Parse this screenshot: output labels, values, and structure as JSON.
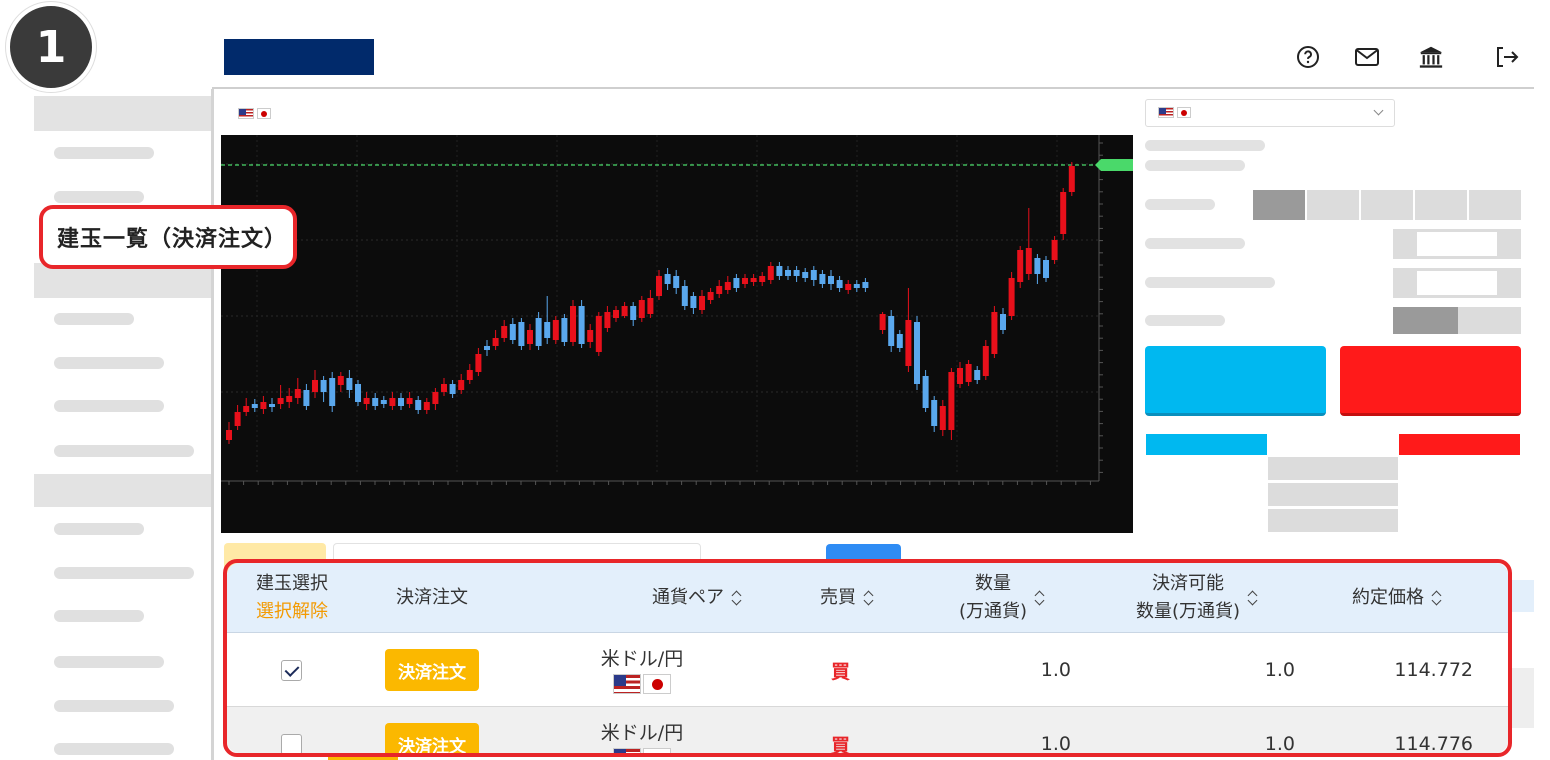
{
  "step": {
    "number": "1"
  },
  "callout": {
    "label": "建玉一覧（決済注文）"
  },
  "header": {
    "icons": [
      "help-icon",
      "mail-icon",
      "bank-icon",
      "logout-icon"
    ],
    "brand_color": "#012a6b"
  },
  "colors": {
    "candle_up": "#e8101b",
    "candle_down": "#5aa8ee",
    "price_line": "#4ad96a",
    "buy_button": "#00b8f0",
    "sell_button": "#ff1a1a",
    "order_button": "#fbb800",
    "highlight": "#e8262a"
  },
  "chart_data": {
    "type": "candlestick",
    "candles": [
      [
        0,
        430,
        440,
        422,
        444
      ],
      [
        0,
        412,
        426,
        405,
        430
      ],
      [
        0,
        406,
        412,
        398,
        416
      ],
      [
        1,
        404,
        408,
        399,
        412
      ],
      [
        0,
        402,
        409,
        396,
        414
      ],
      [
        1,
        404,
        407,
        398,
        412
      ],
      [
        0,
        398,
        404,
        385,
        409
      ],
      [
        0,
        396,
        402,
        388,
        408
      ],
      [
        0,
        389,
        398,
        378,
        404
      ],
      [
        1,
        390,
        406,
        384,
        410
      ],
      [
        0,
        380,
        392,
        370,
        398
      ],
      [
        1,
        380,
        392,
        376,
        402
      ],
      [
        1,
        378,
        406,
        372,
        412
      ],
      [
        0,
        376,
        385,
        372,
        392
      ],
      [
        1,
        378,
        390,
        370,
        398
      ],
      [
        1,
        384,
        402,
        380,
        406
      ],
      [
        0,
        398,
        404,
        392,
        410
      ],
      [
        1,
        398,
        406,
        393,
        410
      ],
      [
        1,
        400,
        404,
        396,
        408
      ],
      [
        0,
        398,
        406,
        392,
        410
      ],
      [
        1,
        398,
        406,
        393,
        410
      ],
      [
        0,
        398,
        404,
        392,
        408
      ],
      [
        1,
        400,
        410,
        396,
        414
      ],
      [
        0,
        402,
        410,
        398,
        414
      ],
      [
        0,
        392,
        404,
        388,
        410
      ],
      [
        0,
        384,
        392,
        378,
        396
      ],
      [
        1,
        384,
        394,
        380,
        398
      ],
      [
        0,
        380,
        390,
        374,
        394
      ],
      [
        0,
        370,
        380,
        364,
        384
      ],
      [
        0,
        354,
        372,
        348,
        376
      ],
      [
        1,
        346,
        350,
        340,
        356
      ],
      [
        0,
        338,
        346,
        330,
        350
      ],
      [
        0,
        326,
        338,
        320,
        342
      ],
      [
        1,
        324,
        340,
        318,
        344
      ],
      [
        1,
        322,
        346,
        318,
        350
      ],
      [
        0,
        330,
        344,
        324,
        350
      ],
      [
        1,
        318,
        346,
        312,
        350
      ],
      [
        1,
        322,
        338,
        296,
        344
      ],
      [
        0,
        320,
        340,
        316,
        344
      ],
      [
        1,
        318,
        342,
        314,
        346
      ],
      [
        0,
        306,
        342,
        300,
        346
      ],
      [
        1,
        306,
        344,
        300,
        348
      ],
      [
        0,
        330,
        342,
        324,
        348
      ],
      [
        0,
        316,
        352,
        312,
        356
      ],
      [
        0,
        312,
        328,
        306,
        332
      ],
      [
        0,
        310,
        318,
        306,
        322
      ],
      [
        0,
        306,
        316,
        302,
        318
      ],
      [
        1,
        306,
        320,
        302,
        326
      ],
      [
        0,
        300,
        318,
        296,
        322
      ],
      [
        0,
        298,
        314,
        290,
        318
      ],
      [
        0,
        276,
        296,
        270,
        300
      ],
      [
        1,
        274,
        284,
        268,
        290
      ],
      [
        1,
        276,
        288,
        270,
        294
      ],
      [
        1,
        286,
        306,
        280,
        310
      ],
      [
        1,
        296,
        308,
        292,
        314
      ],
      [
        0,
        296,
        310,
        290,
        314
      ],
      [
        0,
        292,
        300,
        288,
        304
      ],
      [
        0,
        286,
        294,
        280,
        298
      ],
      [
        0,
        282,
        290,
        276,
        294
      ],
      [
        1,
        278,
        288,
        274,
        292
      ],
      [
        0,
        278,
        284,
        274,
        288
      ],
      [
        0,
        278,
        282,
        274,
        286
      ],
      [
        0,
        276,
        282,
        272,
        286
      ],
      [
        0,
        266,
        280,
        262,
        284
      ],
      [
        1,
        266,
        276,
        262,
        280
      ],
      [
        1,
        270,
        276,
        266,
        280
      ],
      [
        1,
        270,
        276,
        266,
        282
      ],
      [
        1,
        272,
        278,
        268,
        282
      ],
      [
        1,
        270,
        280,
        266,
        286
      ],
      [
        1,
        274,
        284,
        270,
        288
      ],
      [
        1,
        276,
        284,
        270,
        290
      ],
      [
        1,
        280,
        288,
        276,
        292
      ],
      [
        0,
        284,
        290,
        280,
        294
      ],
      [
        1,
        284,
        288,
        280,
        292
      ],
      [
        1,
        282,
        288,
        278,
        292
      ],
      null,
      [
        0,
        314,
        330,
        312,
        334
      ],
      [
        1,
        316,
        346,
        310,
        352
      ],
      [
        1,
        334,
        348,
        330,
        352
      ],
      [
        0,
        320,
        366,
        288,
        372
      ],
      [
        1,
        322,
        384,
        316,
        390
      ],
      [
        1,
        376,
        408,
        370,
        412
      ],
      [
        1,
        400,
        426,
        396,
        432
      ],
      [
        0,
        406,
        430,
        400,
        436
      ],
      [
        0,
        372,
        430,
        368,
        440
      ],
      [
        0,
        368,
        384,
        362,
        388
      ],
      [
        0,
        364,
        382,
        360,
        386
      ],
      [
        1,
        370,
        380,
        366,
        384
      ],
      [
        0,
        346,
        376,
        340,
        380
      ],
      [
        0,
        312,
        354,
        306,
        358
      ],
      [
        1,
        314,
        330,
        308,
        334
      ],
      [
        0,
        278,
        316,
        272,
        320
      ],
      [
        0,
        250,
        282,
        246,
        288
      ],
      [
        0,
        248,
        274,
        208,
        280
      ],
      [
        1,
        258,
        274,
        254,
        284
      ],
      [
        1,
        260,
        278,
        256,
        282
      ],
      [
        0,
        240,
        260,
        236,
        264
      ],
      [
        0,
        192,
        234,
        188,
        240
      ],
      [
        0,
        166,
        192,
        162,
        196
      ]
    ],
    "price_line_y": 165
  },
  "tabs": {
    "count": 3
  },
  "table": {
    "headers": {
      "select": "建玉選択",
      "deselect": "選択解除",
      "order": "決済注文",
      "pair": "通貨ペア",
      "side": "売買",
      "qty_line1": "数量",
      "qty_line2": "(万通貨)",
      "avail_line1": "決済可能",
      "avail_line2": "数量(万通貨)",
      "price": "約定価格"
    },
    "rows": [
      {
        "checked": true,
        "order_label": "決済注文",
        "pair": "米ドル/円",
        "side": "買",
        "qty": "1.0",
        "avail": "1.0",
        "price": "114.772"
      },
      {
        "checked": false,
        "order_label": "決済注文",
        "pair": "米ドル/円",
        "side": "買",
        "qty": "1.0",
        "avail": "1.0",
        "price": "114.776"
      }
    ]
  }
}
